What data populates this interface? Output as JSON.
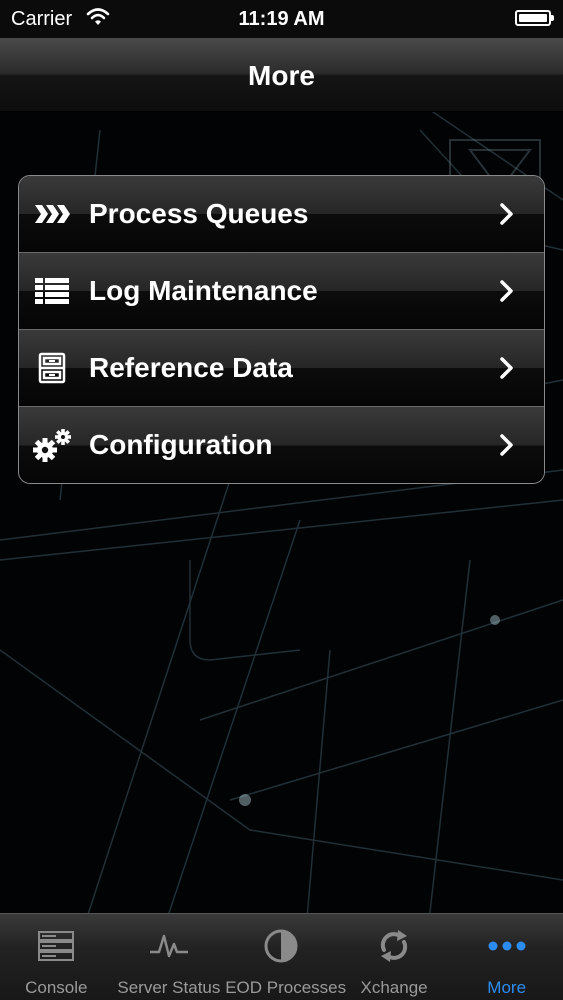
{
  "status_bar": {
    "carrier": "Carrier",
    "time": "11:19 AM",
    "battery_level": 1.0
  },
  "nav": {
    "title": "More"
  },
  "menu": {
    "items": [
      {
        "label": "Process Queues",
        "icon": "process-queues-icon"
      },
      {
        "label": "Log Maintenance",
        "icon": "list-icon"
      },
      {
        "label": "Reference Data",
        "icon": "file-cabinet-icon"
      },
      {
        "label": "Configuration",
        "icon": "gears-icon"
      }
    ]
  },
  "tab_bar": {
    "tabs": [
      {
        "label": "Console",
        "icon": "server-rack-icon",
        "active": false
      },
      {
        "label": "Server Status",
        "icon": "pulse-icon",
        "active": false
      },
      {
        "label": "EOD Processes",
        "icon": "half-circle-icon",
        "active": false
      },
      {
        "label": "Xchange",
        "icon": "sync-arrows-icon",
        "active": false
      },
      {
        "label": "More",
        "icon": "more-dots-icon",
        "active": true
      }
    ]
  },
  "colors": {
    "active_tab": "#2d8cf0",
    "inactive_tab": "#9a9a9a",
    "background": "#020304"
  }
}
